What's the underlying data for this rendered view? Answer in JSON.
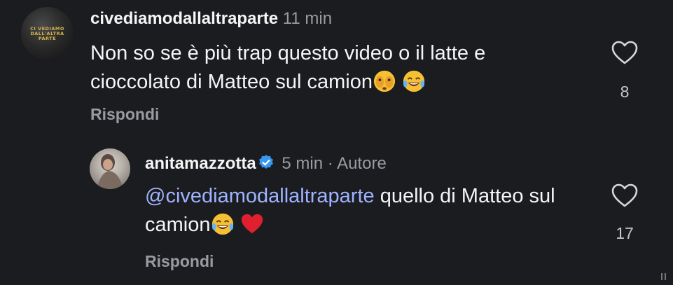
{
  "comments": [
    {
      "username": "civediamodallaltraparte",
      "time": "11 min",
      "avatar_text": "CI VEDIAMO DALL'ALTRA PARTE",
      "text": "Non so se è più trap questo video o il latte e cioccolato di Matteo sul camion",
      "emojis": [
        "face-with-peeking-eye",
        "face-with-tears-of-joy"
      ],
      "reply_label": "Rispondi",
      "likes": "8"
    },
    {
      "username": "anitamazzotta",
      "verified": true,
      "time": "5 min",
      "separator": "·",
      "role": "Autore",
      "mention": "@civediamodallaltraparte",
      "text": "quello di Matteo sul camion",
      "emojis": [
        "face-with-tears-of-joy",
        "red-heart"
      ],
      "reply_label": "Rispondi",
      "likes": "17"
    }
  ],
  "colors": {
    "background": "#1b1c20",
    "text": "#f5f5f5",
    "muted": "#9a9ba0",
    "mention": "#9fb3ff",
    "verified": "#3897f0"
  }
}
